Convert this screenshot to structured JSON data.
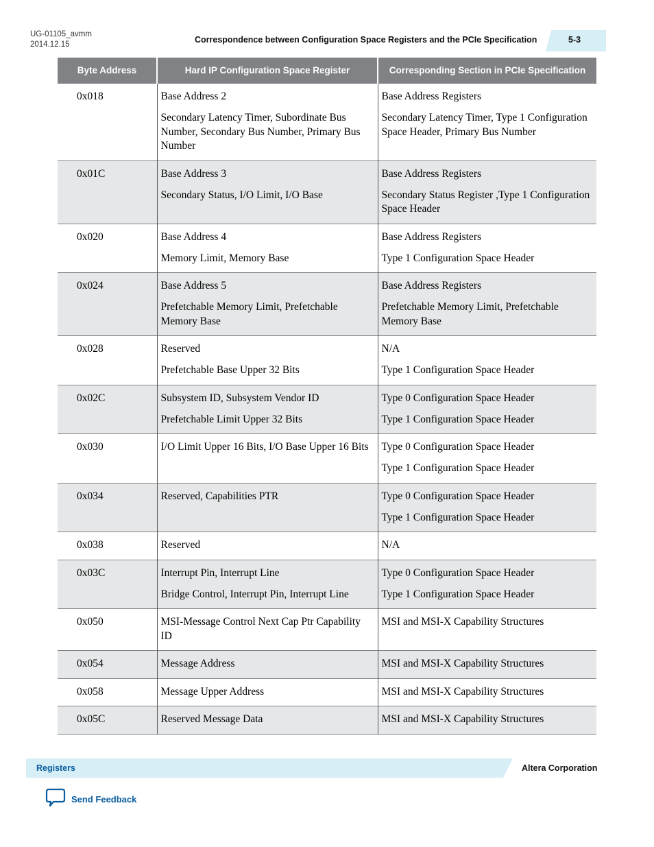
{
  "header": {
    "doc_id": "UG-01105_avmm",
    "date": "2014.12.15",
    "title": "Correspondence between Configuration Space Registers and the PCIe Specification",
    "page_number": "5-3"
  },
  "table": {
    "columns": [
      "Byte Address",
      "Hard IP Configuration Space Register",
      "Corresponding Section in PCIe Specification"
    ],
    "rows": [
      {
        "address": "0x018",
        "register": [
          "Base Address 2",
          "Secondary Latency Timer, Subordinate Bus Number, Secondary Bus Number, Primary Bus Number"
        ],
        "section": [
          "Base Address Registers",
          "Secondary Latency Timer, Type 1 Configuration Space Header, Primary Bus Number"
        ]
      },
      {
        "address": "0x01C",
        "register": [
          "Base Address 3",
          "Secondary Status, I/O Limit, I/O Base"
        ],
        "section": [
          "Base Address Registers",
          "Secondary Status Register ,Type 1 Configuration Space Header"
        ]
      },
      {
        "address": "0x020",
        "register": [
          "Base Address 4",
          "Memory Limit, Memory Base"
        ],
        "section": [
          "Base Address Registers",
          "Type 1 Configuration Space Header"
        ]
      },
      {
        "address": "0x024",
        "register": [
          "Base Address 5",
          "Prefetchable Memory Limit, Prefetchable Memory Base"
        ],
        "section": [
          "Base Address Registers",
          "Prefetchable Memory Limit, Prefetchable Memory Base"
        ]
      },
      {
        "address": "0x028",
        "register": [
          "Reserved",
          "Prefetchable Base Upper 32 Bits"
        ],
        "section": [
          "N/A",
          "Type 1 Configuration Space Header"
        ]
      },
      {
        "address": "0x02C",
        "register": [
          "Subsystem ID, Subsystem Vendor ID",
          "Prefetchable Limit Upper 32 Bits"
        ],
        "section": [
          "Type 0 Configuration Space Header",
          "Type 1 Configuration Space Header"
        ]
      },
      {
        "address": "0x030",
        "register": [
          "I/O Limit Upper 16 Bits, I/O Base Upper 16 Bits"
        ],
        "section": [
          "Type 0 Configuration Space Header",
          "Type 1 Configuration Space Header"
        ]
      },
      {
        "address": "0x034",
        "register": [
          "Reserved, Capabilities PTR"
        ],
        "section": [
          "Type 0 Configuration Space Header",
          "Type 1 Configuration Space Header"
        ]
      },
      {
        "address": "0x038",
        "register": [
          "Reserved"
        ],
        "section": [
          "N/A"
        ]
      },
      {
        "address": "0x03C",
        "register": [
          "Interrupt Pin, Interrupt Line",
          "Bridge Control, Interrupt Pin, Interrupt Line"
        ],
        "section": [
          "Type 0 Configuration Space Header",
          "Type 1 Configuration Space Header"
        ]
      },
      {
        "address": "0x050",
        "register": [
          "MSI-Message Control Next Cap Ptr Capability ID"
        ],
        "section": [
          "MSI and MSI-X Capability Structures"
        ]
      },
      {
        "address": "0x054",
        "register": [
          "Message Address"
        ],
        "section": [
          "MSI and MSI-X Capability Structures"
        ]
      },
      {
        "address": "0x058",
        "register": [
          "Message Upper Address"
        ],
        "section": [
          "MSI and MSI-X Capability Structures"
        ]
      },
      {
        "address": "0x05C",
        "register": [
          "Reserved Message Data"
        ],
        "section": [
          "MSI and MSI-X Capability Structures"
        ]
      }
    ]
  },
  "footer": {
    "section": "Registers",
    "company": "Altera Corporation",
    "feedback_label": "Send Feedback",
    "feedback_icon": "speech-bubble-icon"
  },
  "colors": {
    "header_bg": "#808285",
    "alt_row_bg": "#e6e7e8",
    "band_bg": "#d6eef6",
    "link": "#0a5ea0"
  }
}
